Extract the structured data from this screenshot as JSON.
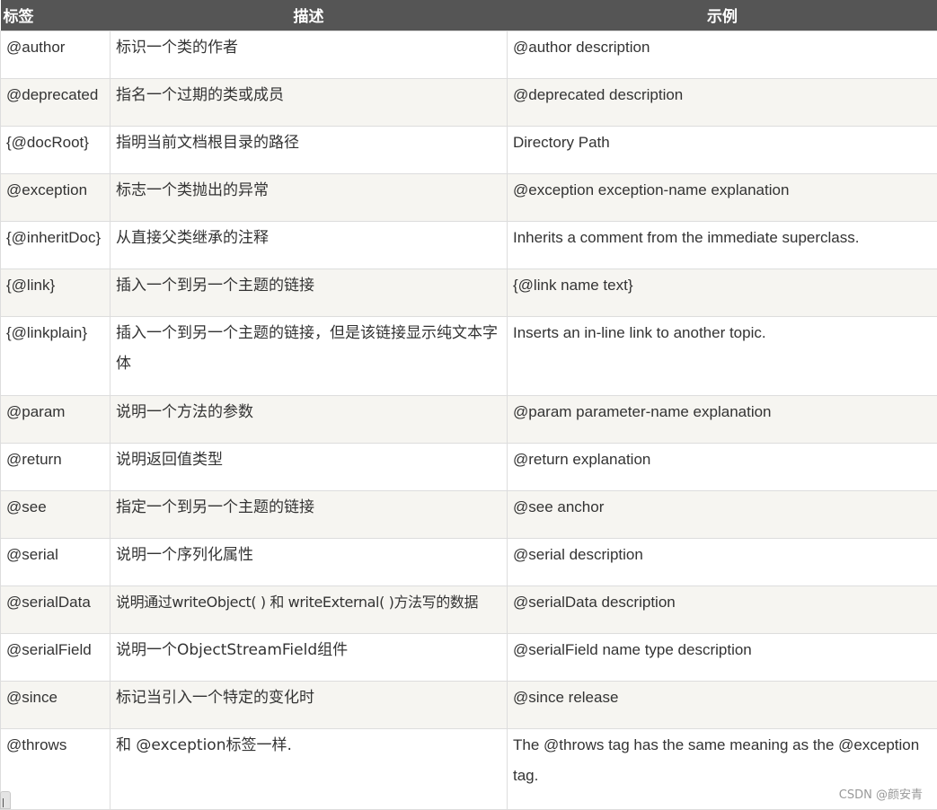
{
  "table": {
    "headers": [
      "标签",
      "描述",
      "示例"
    ],
    "rows": [
      {
        "tag": "@author",
        "desc": "标识一个类的作者",
        "example": "@author description"
      },
      {
        "tag": "@deprecated",
        "desc": "指名一个过期的类或成员",
        "example": "@deprecated description"
      },
      {
        "tag": "{@docRoot}",
        "desc": "指明当前文档根目录的路径",
        "example": "Directory Path"
      },
      {
        "tag": "@exception",
        "desc": "标志一个类抛出的异常",
        "example": "@exception exception-name explanation"
      },
      {
        "tag": "{@inheritDoc}",
        "desc": "从直接父类继承的注释",
        "example": "Inherits a comment from the immediate superclass."
      },
      {
        "tag": "{@link}",
        "desc": "插入一个到另一个主题的链接",
        "example": "{@link name text}"
      },
      {
        "tag": "{@linkplain}",
        "desc": "插入一个到另一个主题的链接，但是该链接显示纯文本字体",
        "example": "Inserts an in-line link to another topic."
      },
      {
        "tag": "@param",
        "desc": "说明一个方法的参数",
        "example": "@param parameter-name explanation"
      },
      {
        "tag": "@return",
        "desc": "说明返回值类型",
        "example": "@return explanation"
      },
      {
        "tag": "@see",
        "desc": "指定一个到另一个主题的链接",
        "example": "@see anchor"
      },
      {
        "tag": "@serial",
        "desc": "说明一个序列化属性",
        "example": "@serial description"
      },
      {
        "tag": "@serialData",
        "desc": "说明通过writeObject( ) 和 writeExternal( )方法写的数据",
        "example": "@serialData description"
      },
      {
        "tag": "@serialField",
        "desc": "说明一个ObjectStreamField组件",
        "example": "@serialField name type description"
      },
      {
        "tag": "@since",
        "desc": "标记当引入一个特定的变化时",
        "example": "@since release"
      },
      {
        "tag": "@throws",
        "desc": "和 @exception标签一样.",
        "example": "The @throws tag has the same meaning as the @exception tag."
      }
    ]
  },
  "watermark": "CSDN @颜安青",
  "colors": {
    "header_bg": "#555555",
    "header_text": "#ffffff",
    "stripe_bg": "#f6f5f1",
    "border": "#dddddd",
    "cell_text": "#333333"
  }
}
